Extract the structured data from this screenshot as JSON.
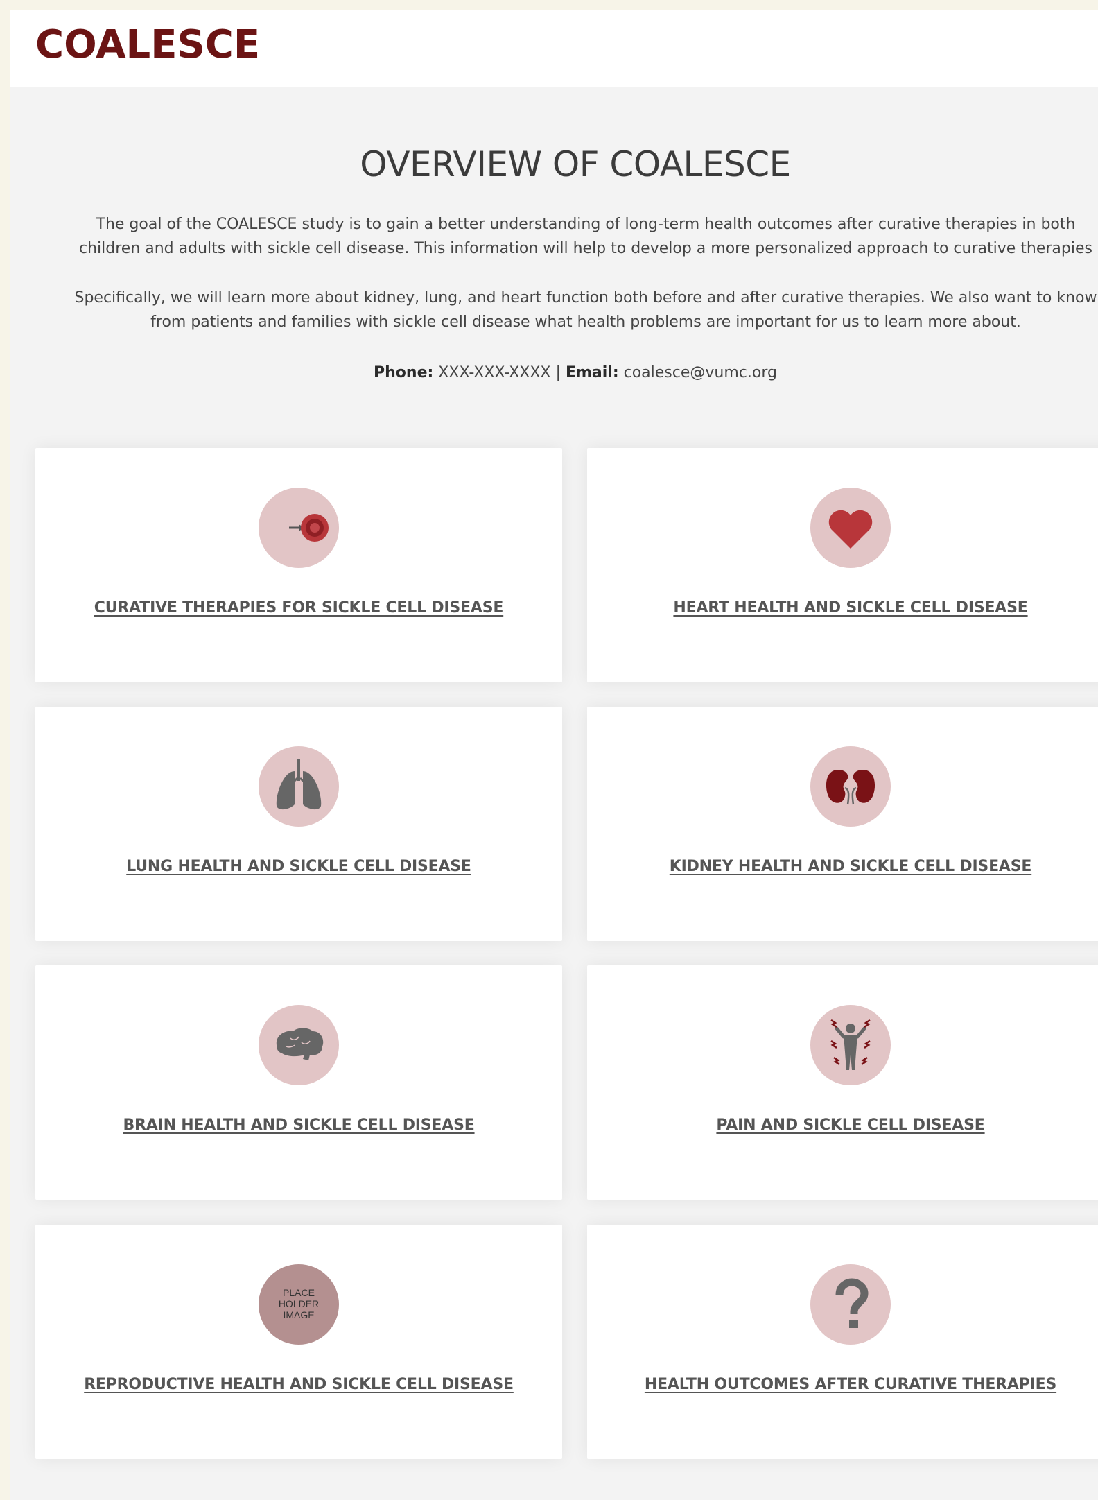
{
  "header": {
    "logo": "COALESCE"
  },
  "overview": {
    "title": "OVERVIEW OF COALESCE",
    "paragraph1_line1": "The goal of the COALESCE study is to gain a better understanding of long-term health outcomes after curative therapies in both",
    "paragraph1_line2": "children and adults with sickle cell disease. This information will help to develop a more personalized approach to curative therapies",
    "paragraph2_line1": "Specifically, we will learn more about kidney, lung, and heart function both before and after curative therapies. We also want to know",
    "paragraph2_line2": "from patients and families with sickle cell disease what health problems are important for us to learn more about.",
    "phone_label": "Phone:",
    "phone_value": "XXX-XXX-XXXX",
    "separator": "|",
    "email_label": "Email:",
    "email_value": "coalesce@vumc.org"
  },
  "cards": [
    {
      "label": "CURATIVE THERAPIES FOR SICKLE CELL DISEASE",
      "icon": "blood-cell-therapy-icon"
    },
    {
      "label": "HEART HEALTH AND SICKLE CELL DISEASE",
      "icon": "heart-icon"
    },
    {
      "label": "LUNG HEALTH AND SICKLE CELL DISEASE",
      "icon": "lungs-icon"
    },
    {
      "label": "KIDNEY HEALTH AND SICKLE CELL DISEASE",
      "icon": "kidneys-icon"
    },
    {
      "label": "BRAIN HEALTH AND SICKLE CELL DISEASE",
      "icon": "brain-icon"
    },
    {
      "label": "PAIN AND SICKLE CELL DISEASE",
      "icon": "pain-figure-icon"
    },
    {
      "label": "REPRODUCTIVE HEALTH AND SICKLE CELL DISEASE",
      "icon": "placeholder-image-icon",
      "icon_text": [
        "PLACE",
        "HOLDER",
        "IMAGE"
      ]
    },
    {
      "label": "HEALTH OUTCOMES AFTER CURATIVE THERAPIES",
      "icon": "question-mark-icon"
    }
  ],
  "colors": {
    "brand": "#6b1414",
    "icon_circle": "#e2c5c6",
    "icon_red": "#b8363a",
    "icon_dark_red": "#7a1216",
    "icon_gray": "#666666",
    "text": "#444444"
  }
}
